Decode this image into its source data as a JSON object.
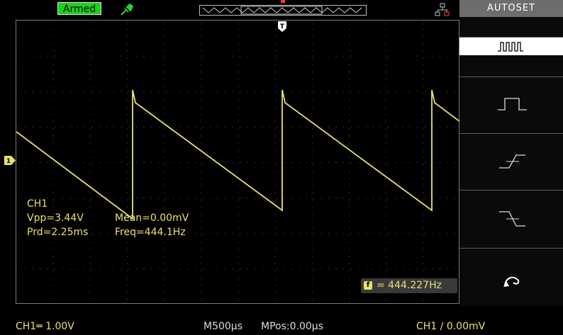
{
  "header": {
    "status": "Armed",
    "icons": [
      "probe-icon",
      "network-icon"
    ]
  },
  "side_menu": {
    "title": "AUTOSET",
    "options": [
      {
        "name": "multi-period-icon",
        "selected": true
      },
      {
        "name": "single-period-icon",
        "selected": false
      },
      {
        "name": "rising-edge-icon",
        "selected": false
      },
      {
        "name": "falling-edge-icon",
        "selected": false
      },
      {
        "name": "undo-icon",
        "selected": false
      }
    ]
  },
  "measurements": {
    "channel": "CH1",
    "vpp": "Vpp=3.44V",
    "mean": "Mean=0.00mV",
    "prd": "Prd=2.25ms",
    "freq": "Freq=444.1Hz"
  },
  "frequency_counter": {
    "icon": "f",
    "value": "= 444.227Hz"
  },
  "markers": {
    "trigger": "T",
    "ch1": "1"
  },
  "status_bar": {
    "ch1_scale": "CH1═ 1.00V",
    "timebase": "M500µs",
    "mpos": "MPos:0.00µs",
    "trigger": "CH1 ∕ 0.00mV"
  },
  "colors": {
    "trace": "#e8e070",
    "armed": "#1bd11b",
    "grid": "#5a5a5a"
  },
  "waveform": {
    "type": "sawtooth",
    "frequency_hz": 444.227,
    "vpp_v": 3.44
  }
}
